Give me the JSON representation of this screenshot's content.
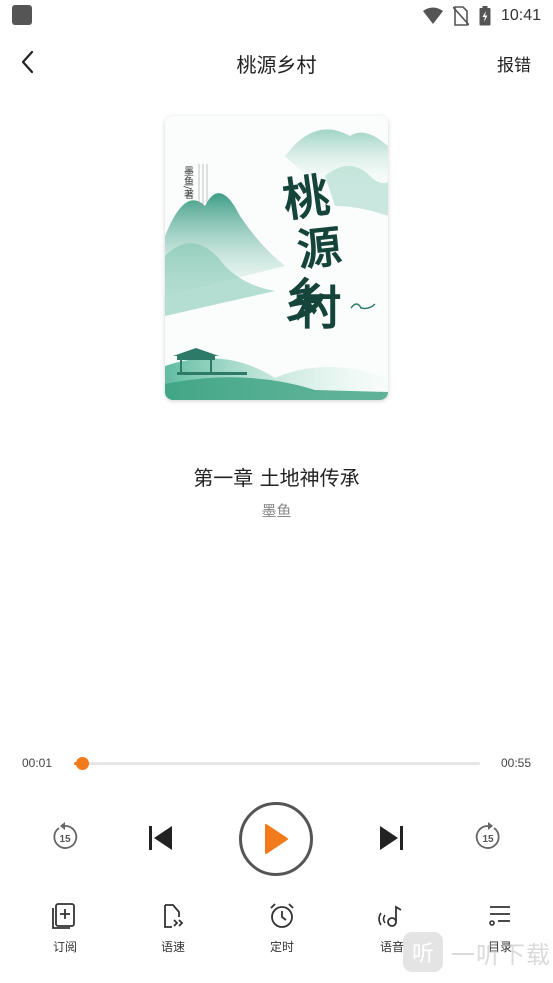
{
  "status_bar": {
    "time": "10:41",
    "icons": [
      "app-icon",
      "wifi-icon",
      "no-sim-icon",
      "battery-charging-icon"
    ]
  },
  "header": {
    "title": "桃源乡村",
    "back_icon": "chevron-left-icon",
    "report_label": "报错"
  },
  "cover": {
    "title_chars": [
      "桃",
      "源",
      "乡",
      "村"
    ],
    "author_tag": "墨鱼/著"
  },
  "track": {
    "chapter": "第一章 土地神传承",
    "author": "墨鱼"
  },
  "player": {
    "current_time": "00:01",
    "total_time": "00:55",
    "progress": 0.02,
    "rewind_label": "15",
    "forward_label": "15",
    "accent_color": "#f27a1a"
  },
  "nav": {
    "items": [
      {
        "label": "订阅",
        "icon": "subscribe-icon"
      },
      {
        "label": "语速",
        "icon": "speed-icon"
      },
      {
        "label": "定时",
        "icon": "alarm-icon"
      },
      {
        "label": "语音",
        "icon": "voice-icon"
      },
      {
        "label": "目录",
        "icon": "catalog-icon"
      }
    ]
  },
  "watermark": {
    "badge": "听",
    "text": "一听下载"
  }
}
